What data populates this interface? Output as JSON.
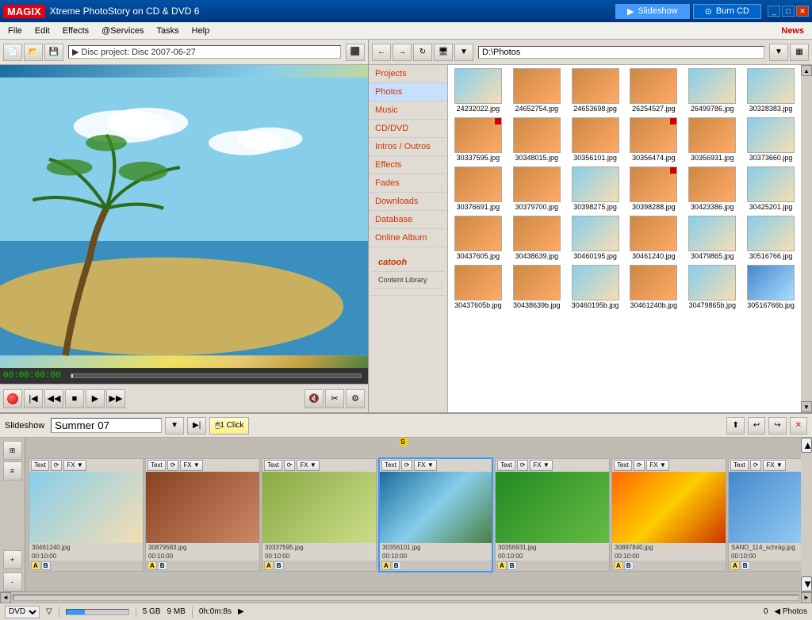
{
  "app": {
    "logo": "MAGIX",
    "title": "Xtreme PhotoStory on CD & DVD 6",
    "tabs": [
      {
        "label": "Slideshow",
        "icon": "▶",
        "active": true
      },
      {
        "label": "Burn CD",
        "icon": "⊙",
        "active": false
      }
    ],
    "win_buttons": [
      "_",
      "□",
      "✕"
    ],
    "news_label": "News"
  },
  "menu": {
    "items": [
      "File",
      "Edit",
      "Effects",
      "@Services",
      "Tasks",
      "Help"
    ]
  },
  "toolbar": {
    "disc_label": "▶  Disc project: Disc 2007-06-27"
  },
  "preview": {
    "time_display": "00:00:00:00"
  },
  "browser": {
    "path": "D:\\Photos",
    "categories": [
      {
        "label": "Projects"
      },
      {
        "label": "Photos",
        "active": true
      },
      {
        "label": "Music"
      },
      {
        "label": "CD/DVD"
      },
      {
        "label": "Intros / Outros"
      },
      {
        "label": "Effects"
      },
      {
        "label": "Fades"
      },
      {
        "label": "Downloads"
      },
      {
        "label": "Database"
      },
      {
        "label": "Online Album"
      },
      {
        "label": "catooh Content Library"
      }
    ],
    "files": [
      {
        "name": "24232022.jpg",
        "thumb": "thumb-beach"
      },
      {
        "name": "24652754.jpg",
        "thumb": "thumb-people"
      },
      {
        "name": "24653698.jpg",
        "thumb": "thumb-people"
      },
      {
        "name": "26254527.jpg",
        "thumb": "thumb-people"
      },
      {
        "name": "26499786.jpg",
        "thumb": "thumb-beach"
      },
      {
        "name": "30328383.jpg",
        "thumb": "thumb-beach"
      },
      {
        "name": "30337595.jpg",
        "thumb": "thumb-people",
        "red": true
      },
      {
        "name": "30348015.jpg",
        "thumb": "thumb-people"
      },
      {
        "name": "30356101.jpg",
        "thumb": "thumb-people"
      },
      {
        "name": "30356474.jpg",
        "thumb": "thumb-people",
        "red": true
      },
      {
        "name": "30356931.jpg",
        "thumb": "thumb-people"
      },
      {
        "name": "30373660.jpg",
        "thumb": "thumb-beach"
      },
      {
        "name": "30376691.jpg",
        "thumb": "thumb-people"
      },
      {
        "name": "30379700.jpg",
        "thumb": "thumb-people"
      },
      {
        "name": "30398275.jpg",
        "thumb": "thumb-beach"
      },
      {
        "name": "30398288.jpg",
        "thumb": "thumb-people",
        "red": true
      },
      {
        "name": "30423386.jpg",
        "thumb": "thumb-people"
      },
      {
        "name": "30425201.jpg",
        "thumb": "thumb-beach"
      },
      {
        "name": "30437605.jpg",
        "thumb": "thumb-people"
      },
      {
        "name": "30438639.jpg",
        "thumb": "thumb-people"
      },
      {
        "name": "30460195.jpg",
        "thumb": "thumb-beach"
      },
      {
        "name": "30461240.jpg",
        "thumb": "thumb-people"
      },
      {
        "name": "30479865.jpg",
        "thumb": "thumb-beach"
      },
      {
        "name": "30516766.jpg",
        "thumb": "thumb-beach"
      },
      {
        "name": "30437605b.jpg",
        "thumb": "thumb-people"
      },
      {
        "name": "30438639b.jpg",
        "thumb": "thumb-people"
      },
      {
        "name": "30460195b.jpg",
        "thumb": "thumb-beach"
      },
      {
        "name": "30461240b.jpg",
        "thumb": "thumb-people"
      },
      {
        "name": "30479865b.jpg",
        "thumb": "thumb-beach"
      },
      {
        "name": "30516766b.jpg",
        "thumb": "thumb-sky"
      }
    ]
  },
  "slideshow": {
    "label": "Slideshow",
    "name": "Summer 07",
    "oneclick_label": "1 Click",
    "toolbar_buttons": [
      "▶|",
      "◀",
      "▶",
      "✕"
    ]
  },
  "filmstrip": {
    "items": [
      {
        "filename": "30461240.jpg",
        "duration": "00:10:00",
        "thumb": "thumb-beach",
        "text": "Text",
        "active": false
      },
      {
        "filename": "30879583.jpg",
        "duration": "00:10:00",
        "thumb": "thumb-couple",
        "text": "Text",
        "active": false
      },
      {
        "filename": "30337595.jpg",
        "duration": "00:10:00",
        "thumb": "thumb-group",
        "text": "Text",
        "active": false
      },
      {
        "filename": "30356101.jpg",
        "duration": "00:10:00",
        "thumb": "thumb-palm",
        "text": "Text",
        "active": true
      },
      {
        "filename": "30356931.jpg",
        "duration": "00:10:00",
        "thumb": "thumb-forest",
        "text": "Text",
        "active": false
      },
      {
        "filename": "30897840.jpg",
        "duration": "00:10:00",
        "thumb": "thumb-sunset",
        "text": "Text",
        "active": false
      },
      {
        "filename": "SAND_114_schräg.jpg",
        "duration": "00:10:00",
        "thumb": "thumb-sky",
        "text": "Text",
        "active": false
      }
    ]
  },
  "statusbar": {
    "format": "DVD",
    "size1": "5 GB",
    "size2": "9 MB",
    "duration": "0h:0m:8s",
    "count": "0",
    "photos_label": "Photos"
  },
  "icons": {
    "play_icon": "▶",
    "pause_icon": "⏸",
    "stop_icon": "■",
    "prev_icon": "◀◀",
    "next_icon": "▶▶",
    "record_icon": "●",
    "back_icon": "←",
    "forward_icon": "→",
    "refresh_icon": "↻",
    "folder_icon": "📁",
    "grid_icon": "▦",
    "scissors_icon": "✂",
    "arrow_down": "▼",
    "arrow_right": "▶",
    "fx_label": "FX",
    "text_label": "Text"
  }
}
